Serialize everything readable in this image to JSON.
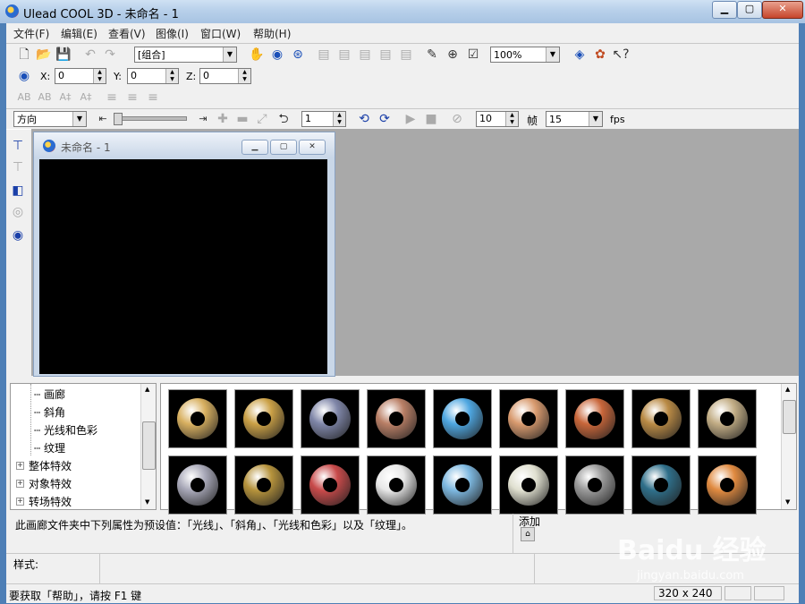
{
  "window": {
    "title": "Ulead COOL 3D - 未命名 - 1"
  },
  "menu": [
    "文件(F)",
    "编辑(E)",
    "查看(V)",
    "图像(I)",
    "窗口(W)",
    "帮助(H)"
  ],
  "toolbar1": {
    "object_combo": "[组合]",
    "zoom": "100%"
  },
  "position": {
    "x_label": "X:",
    "x_value": "0",
    "y_label": "Y:",
    "y_value": "0",
    "z_label": "Z:",
    "z_value": "0"
  },
  "animation": {
    "mode_combo": "方向",
    "frame_value": "1",
    "total_frames": "10",
    "frames_label": "帧",
    "fps_value": "15",
    "fps_label": "fps"
  },
  "child_window": {
    "title": "未命名 - 1"
  },
  "tree": {
    "items": [
      "画廊",
      "斜角",
      "光线和色彩",
      "纹理"
    ],
    "groups": [
      "整体特效",
      "对象特效",
      "转场特效"
    ]
  },
  "gallery": {
    "rings": [
      "#d8b060",
      "#caa046",
      "#7f86a8",
      "#b97f66",
      "#4ea6e0",
      "#d89a6e",
      "#c8663a",
      "#b98a45",
      "#c2ad85",
      "#a8a8b8",
      "#b6933c",
      "#c84a4a",
      "#e8e8e8",
      "#7db8e0",
      "#e0e0d0",
      "#9a9a9a",
      "#2f6f8a",
      "#e08a40"
    ]
  },
  "description": "此画廊文件夹中下列属性为预设值：「光线」、「斜角」、「光线和色彩」以及「纹理」。",
  "add_label": "添加",
  "style_label": "样式:",
  "status": {
    "help": "要获取「帮助」，请按 F1 键",
    "size": "320 x 240"
  },
  "watermark": {
    "brand": "Baidu 经验",
    "url": "jingyan.baidu.com"
  }
}
